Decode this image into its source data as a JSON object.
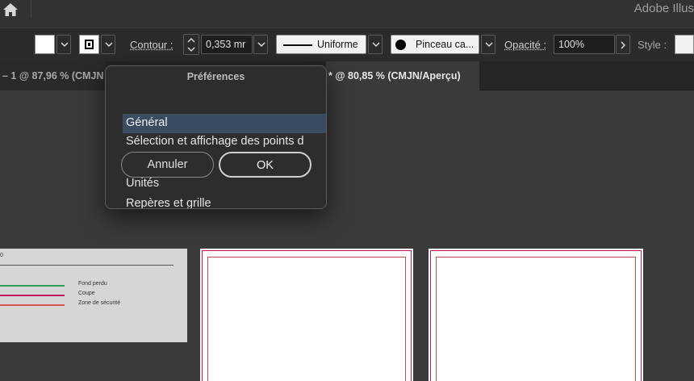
{
  "app": {
    "title": "Adobe Illus"
  },
  "controlbar": {
    "stroke_label": "Contour :",
    "stroke_weight": "0,353 mr",
    "stroke_profile": "Uniforme",
    "brush": "Pinceau ca...",
    "opacity_label": "Opacité :",
    "opacity_value": "100%",
    "style_label": "Style :"
  },
  "tabs": [
    {
      "label": "– 1 @ 87,96 % (CMJN"
    },
    {
      "label": "* @ 80,85 % (CMJN/Aperçu)"
    }
  ],
  "dialog": {
    "title": "Préférences",
    "items": [
      {
        "label": "Général",
        "selected": true
      },
      {
        "label": "Sélection et affichage des points d"
      },
      {
        "label": "Unités"
      },
      {
        "label": "Repères et grille"
      }
    ],
    "cancel_label": "Annuler",
    "ok_label": "OK"
  },
  "canvas": {
    "legend_title": "0",
    "legend": [
      {
        "label": "Fond perdu",
        "color": "#2e9a5a"
      },
      {
        "label": "Coupe",
        "color": "#c2185b"
      },
      {
        "label": "Zone de sécurité",
        "color": "#d9534f"
      }
    ]
  },
  "colors": {
    "accent_selection": "#3b4b62",
    "bleed": "#c2185b",
    "safe": "#c0504d"
  }
}
